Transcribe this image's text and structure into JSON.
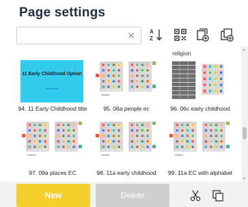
{
  "header": {
    "title": "Page settings"
  },
  "search": {
    "value": "",
    "placeholder": ""
  },
  "toolbar": {
    "sort_icon": "sort-az-icon",
    "qr_icon": "qr-code-icon",
    "add_page_icon": "add-page-icon",
    "copy_page_icon": "copy-page-icon"
  },
  "pages": {
    "partial_label": "religion",
    "items": [
      {
        "caption": "94. 11 Early Childhood title",
        "thumb": "title",
        "thumb_title": "11 Early Childhood Option"
      },
      {
        "caption": "95. 06a people ec",
        "thumb": "symbols"
      },
      {
        "caption": "96. 06c early childhood",
        "thumb": "list"
      },
      {
        "caption": "97. 09a places EC",
        "thumb": "symbols"
      },
      {
        "caption": "98. 11a early childhood",
        "thumb": "symbols"
      },
      {
        "caption": "99. 11a EC with alphabet",
        "thumb": "symbols"
      }
    ]
  },
  "footer": {
    "new_label": "New",
    "delete_label": "Delete",
    "cut_icon": "scissors-icon",
    "duplicate_icon": "duplicate-icon"
  },
  "colors": {
    "accent": "#f5cf2b",
    "disabled": "#cfcfcf",
    "title_thumb_bg": "#33ccf0"
  }
}
